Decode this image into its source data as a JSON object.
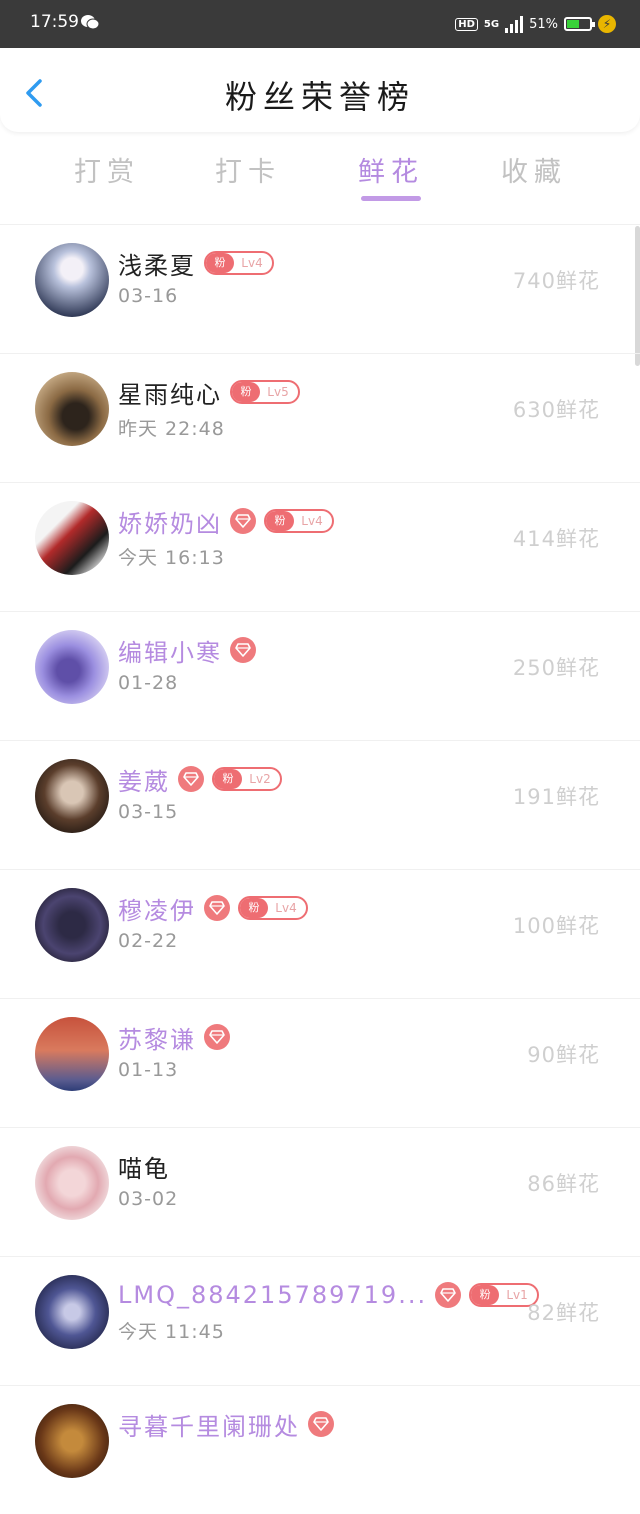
{
  "status_bar": {
    "time": "17:59",
    "hd": "HD",
    "network": "5G",
    "battery_percent": "51%"
  },
  "header": {
    "title": "粉丝荣誉榜"
  },
  "tabs": [
    {
      "label": "打赏",
      "active": false
    },
    {
      "label": "打卡",
      "active": false
    },
    {
      "label": "鲜花",
      "active": true
    },
    {
      "label": "收藏",
      "active": false
    }
  ],
  "fan_badge_label": "粉",
  "entries": [
    {
      "name": "浅柔夏",
      "date": "03-16",
      "count": "740鲜花",
      "vip": false,
      "diamond": false,
      "level": "Lv4"
    },
    {
      "name": "星雨纯心",
      "date": "昨天 22:48",
      "count": "630鲜花",
      "vip": false,
      "diamond": false,
      "level": "Lv5"
    },
    {
      "name": "娇娇奶凶",
      "date": "今天 16:13",
      "count": "414鲜花",
      "vip": true,
      "diamond": true,
      "level": "Lv4"
    },
    {
      "name": "编辑小寒",
      "date": "01-28",
      "count": "250鲜花",
      "vip": true,
      "diamond": true,
      "level": ""
    },
    {
      "name": "姜葳",
      "date": "03-15",
      "count": "191鲜花",
      "vip": true,
      "diamond": true,
      "level": "Lv2"
    },
    {
      "name": "穆凌伊",
      "date": "02-22",
      "count": "100鲜花",
      "vip": true,
      "diamond": true,
      "level": "Lv4"
    },
    {
      "name": "苏黎谦",
      "date": "01-13",
      "count": "90鲜花",
      "vip": true,
      "diamond": true,
      "level": ""
    },
    {
      "name": "喵龟",
      "date": "03-02",
      "count": "86鲜花",
      "vip": false,
      "diamond": false,
      "level": ""
    },
    {
      "name": "LMQ_884215789719...",
      "date": "今天 11:45",
      "count": "82鲜花",
      "vip": true,
      "diamond": true,
      "level": "Lv1"
    },
    {
      "name": "寻暮千里阑珊处",
      "date": "",
      "count": "",
      "vip": true,
      "diamond": true,
      "level": ""
    }
  ],
  "colors": {
    "accent": "#b48ae0",
    "badge_red": "#ee6d72",
    "count_grey": "#cfcfcf"
  }
}
